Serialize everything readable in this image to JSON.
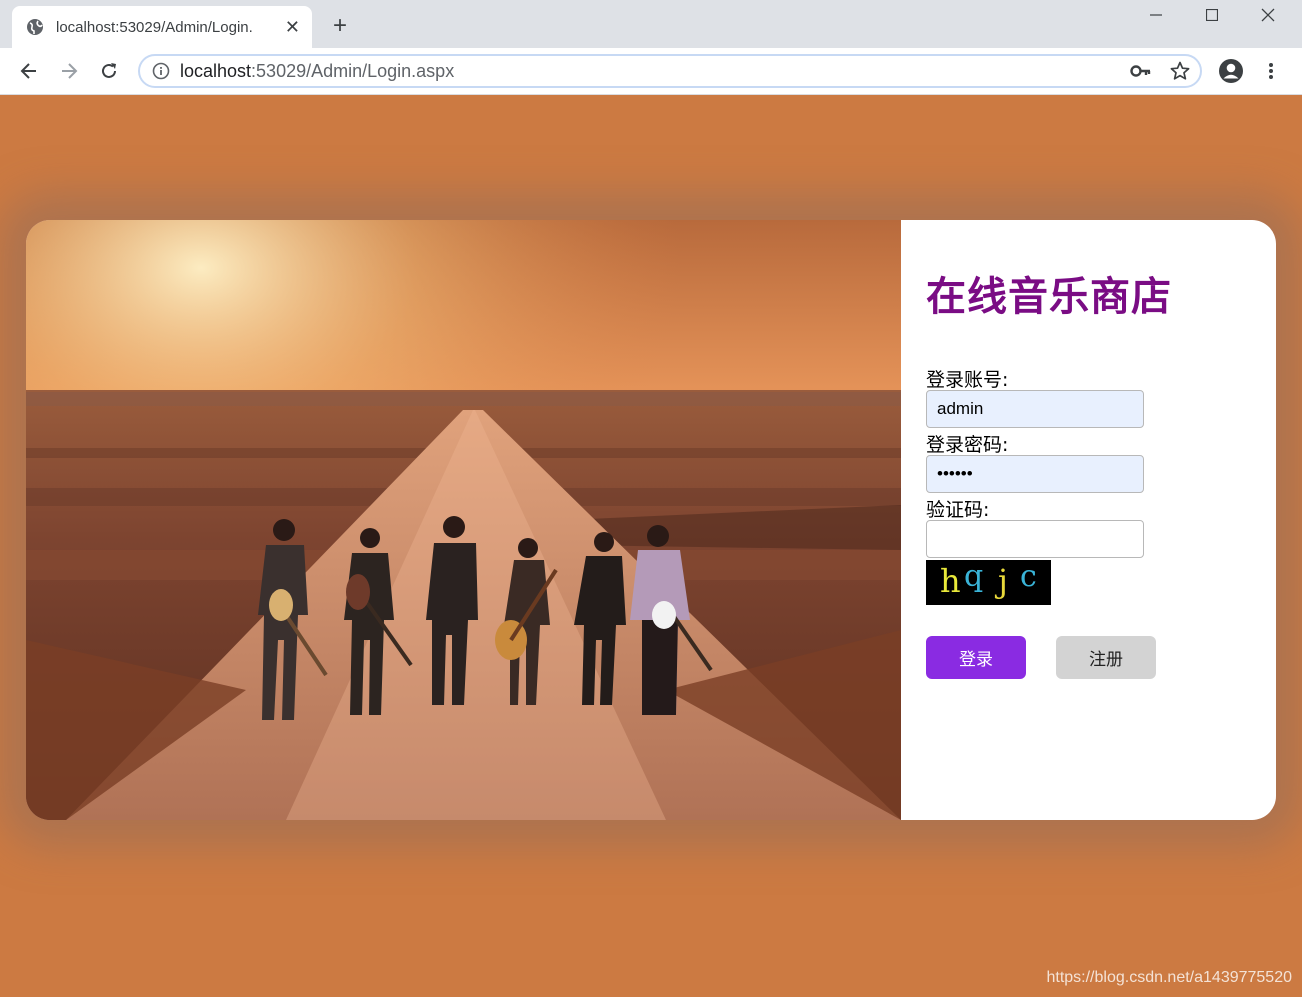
{
  "browser": {
    "tab_title": "localhost:53029/Admin/Login.",
    "tab_close": "✕",
    "new_tab": "+",
    "url_host": "localhost",
    "url_rest": ":53029/Admin/Login.aspx"
  },
  "login": {
    "title": "在线音乐商店",
    "account_label": "登录账号:",
    "account_value": "admin",
    "password_label": "登录密码:",
    "password_value": "••••••",
    "captcha_label": "验证码:",
    "captcha_value": "",
    "captcha_text": [
      "h",
      "q",
      "j",
      "c"
    ],
    "login_button": "登录",
    "register_button": "注册"
  },
  "watermark": "https://blog.csdn.net/a1439775520",
  "icons": {
    "favicon": "globe-icon",
    "back": "arrow-left-icon",
    "forward": "arrow-right-icon",
    "reload": "reload-icon",
    "site_info": "info-icon",
    "password_key": "key-icon",
    "bookmark": "star-icon",
    "profile": "account-icon",
    "menu": "kebab-menu-icon"
  },
  "colors": {
    "page_background": "#cc7a42",
    "title": "#7a0c84",
    "login_button": "#8a2be2",
    "register_button": "#d3d3d3"
  }
}
